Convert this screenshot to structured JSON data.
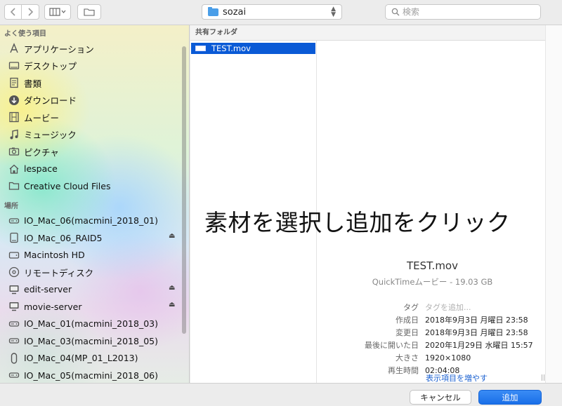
{
  "toolbar": {
    "back_icon": "chevron-left-icon",
    "forward_icon": "chevron-right-icon",
    "view_icon": "column-view-icon",
    "new_folder_icon": "new-folder-icon",
    "path_folder": "sozai",
    "search_placeholder": "検索"
  },
  "sidebar": {
    "favorites_header": "よく使う項目",
    "favorites": [
      {
        "label": "アプリケーション",
        "icon": "applications-icon"
      },
      {
        "label": "デスクトップ",
        "icon": "desktop-icon"
      },
      {
        "label": "書類",
        "icon": "documents-icon"
      },
      {
        "label": "ダウンロード",
        "icon": "downloads-icon"
      },
      {
        "label": "ムービー",
        "icon": "movies-icon"
      },
      {
        "label": "ミュージック",
        "icon": "music-icon"
      },
      {
        "label": "ピクチャ",
        "icon": "pictures-icon"
      },
      {
        "label": "lespace",
        "icon": "home-icon"
      },
      {
        "label": "Creative Cloud Files",
        "icon": "folder-icon"
      }
    ],
    "locations_header": "場所",
    "locations": [
      {
        "label": "IO_Mac_06(macmini_2018_01)",
        "icon": "network-drive-icon",
        "eject": false
      },
      {
        "label": "IO_Mac_06_RAID5",
        "icon": "external-drive-icon",
        "eject": true
      },
      {
        "label": "Macintosh HD",
        "icon": "internal-drive-icon",
        "eject": false
      },
      {
        "label": "リモートディスク",
        "icon": "remote-disc-icon",
        "eject": false
      },
      {
        "label": "edit-server",
        "icon": "server-icon",
        "eject": true
      },
      {
        "label": "movie-server",
        "icon": "server-icon",
        "eject": true
      },
      {
        "label": "IO_Mac_01(macmini_2018_03)",
        "icon": "network-drive-icon",
        "eject": false
      },
      {
        "label": "IO_Mac_03(macmini_2018_05)",
        "icon": "network-drive-icon",
        "eject": false
      },
      {
        "label": "IO_Mac_04(MP_01_L2013)",
        "icon": "mac-pro-icon",
        "eject": false
      },
      {
        "label": "IO_Mac_05(macmini_2018_06)",
        "icon": "network-drive-icon",
        "eject": false
      }
    ],
    "eject_glyph": "⏏"
  },
  "browser": {
    "column_header": "共有フォルダ",
    "selected_file": "TEST.mov"
  },
  "overlay": {
    "caption": "素材を選択し追加をクリック"
  },
  "preview": {
    "name": "TEST.mov",
    "kind": "QuickTimeムービー - 19.03 GB",
    "meta": [
      {
        "key": "タグ",
        "value": "タグを追加...",
        "placeholder": true
      },
      {
        "key": "作成日",
        "value": "2018年9月3日 月曜日 23:58"
      },
      {
        "key": "変更日",
        "value": "2018年9月3日 月曜日 23:58"
      },
      {
        "key": "最後に開いた日",
        "value": "2020年1月29日 水曜日 15:57"
      },
      {
        "key": "大きさ",
        "value": "1920×1080"
      },
      {
        "key": "再生時間",
        "value": "02:04:08"
      }
    ],
    "more_link": "表示項目を増やす"
  },
  "footer": {
    "cancel_label": "キャンセル",
    "add_label": "追加"
  },
  "colors": {
    "accent": "#1a6fe8",
    "selection": "#0a5ad6",
    "link": "#1a60d0"
  }
}
